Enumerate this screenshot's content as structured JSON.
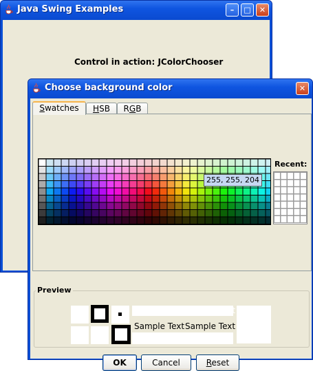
{
  "main_window": {
    "title": "Java Swing Examples",
    "minimize_symbol": "–",
    "maximize_symbol": "□",
    "close_symbol": "✕",
    "content_label": "Control in action: JColorChooser"
  },
  "dialog": {
    "title": "Choose background color",
    "close_symbol": "✕",
    "tabs": [
      {
        "label_first": "S",
        "label_rest": "watches",
        "active": true
      },
      {
        "label_first": "H",
        "label_rest": "SB",
        "active": false
      },
      {
        "label_first": "R",
        "label_rest": "GB",
        "active": false,
        "label_pre": "R",
        "label_underlined": "G",
        "label_post": "B"
      }
    ],
    "recent_label": "Recent:",
    "tooltip": "255, 255, 204",
    "preview_label": "Preview",
    "sample_text": "Sample Text",
    "buttons": {
      "ok": "OK",
      "cancel": "Cancel",
      "reset": "Reset"
    },
    "swatch_grid": {
      "columns": 31,
      "rows": 9
    },
    "recent_grid": {
      "columns": 5,
      "rows": 7
    },
    "colors": {
      "titlebar": "#0a4fd6",
      "dialog_background": "#ece9d8",
      "active_tab_accent": "#f7b44a",
      "tooltip_background": "#c6d8f2"
    },
    "icons": [
      "java-cup-icon",
      "close-icon"
    ]
  }
}
